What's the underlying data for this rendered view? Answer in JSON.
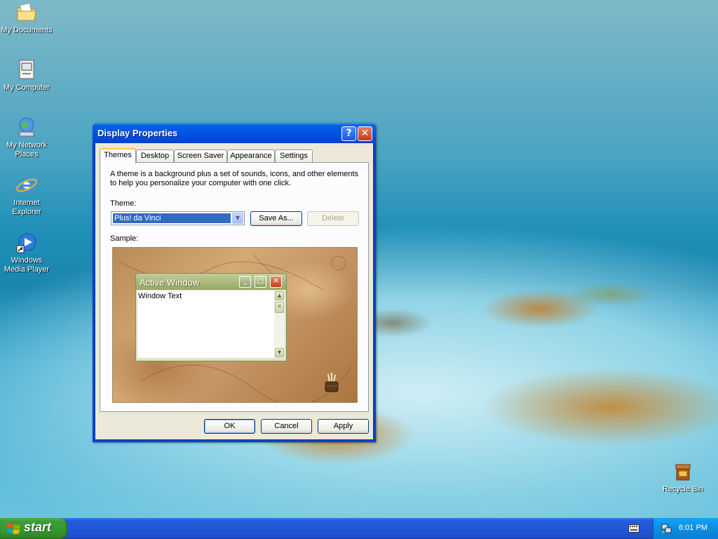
{
  "desktop": {
    "icons": [
      {
        "label": "My Documents",
        "icon": "folder-documents-icon"
      },
      {
        "label": "My Computer",
        "icon": "computer-icon"
      },
      {
        "label": "My Network Places",
        "icon": "network-places-icon"
      },
      {
        "label": "Internet Explorer",
        "icon": "internet-explorer-icon"
      },
      {
        "label": "Windows Media Player",
        "icon": "media-player-icon"
      },
      {
        "label": "Recycle Bin",
        "icon": "recycle-bin-icon"
      }
    ]
  },
  "dialog": {
    "title": "Display Properties",
    "help_glyph": "?",
    "close_glyph": "✕",
    "tabs": [
      "Themes",
      "Desktop",
      "Screen Saver",
      "Appearance",
      "Settings"
    ],
    "active_tab": "Themes",
    "description": "A theme is a background plus a set of sounds, icons, and other elements to help you personalize your computer with one click.",
    "theme_label": "Theme:",
    "theme_value": "Plus! da Vinci",
    "save_as_label": "Save As...",
    "delete_label": "Delete",
    "sample_label": "Sample:",
    "sample": {
      "window_title": "Active Window",
      "window_text": "Window Text"
    },
    "ok_label": "OK",
    "cancel_label": "Cancel",
    "apply_label": "Apply"
  },
  "taskbar": {
    "start_label": "start",
    "clock": "6:01 PM"
  },
  "colors": {
    "title_bar": "#0054e3",
    "start_button": "#3c9c38",
    "taskbar": "#245edb",
    "selection": "#316ac5"
  }
}
